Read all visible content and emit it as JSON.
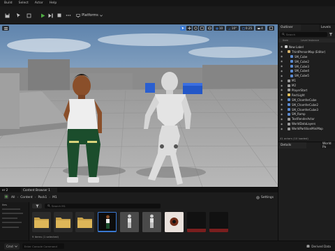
{
  "menu": [
    "Build",
    "Select",
    "Actor",
    "Help"
  ],
  "toolbar": {
    "platforms_label": "Platforms"
  },
  "viewport": {
    "grid_snap": "10",
    "rotation_snap": "10°",
    "scale_snap": "0.25",
    "camera_speed": "4"
  },
  "outliner": {
    "tab_outliner": "Outliner",
    "tab_levels": "Levels",
    "search_placeholder": "Search",
    "col_item": "Item",
    "col_level": "Level Instance",
    "items": [
      {
        "label": "New Label",
        "indent": 0,
        "color": "#cfcfcf"
      },
      {
        "label": "ThirdPersonMap (Editor)",
        "indent": 1,
        "color": "#d8b46a"
      },
      {
        "label": "SM_Cube",
        "indent": 2,
        "color": "#5b8ad0"
      },
      {
        "label": "SM_Cube2",
        "indent": 2,
        "color": "#5b8ad0"
      },
      {
        "label": "SM_Cube3",
        "indent": 2,
        "color": "#5b8ad0"
      },
      {
        "label": "SM_Cube4",
        "indent": 2,
        "color": "#5b8ad0"
      },
      {
        "label": "SM_Cube5",
        "indent": 2,
        "color": "#5b8ad0"
      },
      {
        "label": "M1",
        "indent": 1,
        "color": "#9b9b9b"
      },
      {
        "label": "M2",
        "indent": 1,
        "color": "#9b9b9b"
      },
      {
        "label": "PlayerStart",
        "indent": 1,
        "color": "#9b9b9b"
      },
      {
        "label": "RectLight",
        "indent": 1,
        "color": "#e2c05a"
      },
      {
        "label": "SM_ChamferCube",
        "indent": 1,
        "color": "#5b8ad0"
      },
      {
        "label": "SM_ChamferCube2",
        "indent": 1,
        "color": "#5b8ad0"
      },
      {
        "label": "SM_ChamferCube3",
        "indent": 1,
        "color": "#5b8ad0"
      },
      {
        "label": "SM_Ramp",
        "indent": 1,
        "color": "#5b8ad0"
      },
      {
        "label": "TextRenderActor",
        "indent": 1,
        "color": "#9b9b9b"
      },
      {
        "label": "WorldDataLayers",
        "indent": 1,
        "color": "#9b9b9b"
      },
      {
        "label": "WorldPartitionMiniMap",
        "indent": 1,
        "color": "#9b9b9b"
      }
    ],
    "footer": "41 actors (10 loaded)"
  },
  "details": {
    "tab_details": "Details",
    "tab_world": "World Pa"
  },
  "content_browser": {
    "tabs": [
      "er 2",
      "Content Browser 1"
    ],
    "path": [
      "All",
      "Content",
      "Pack1",
      "M1"
    ],
    "settings_label": "Settings",
    "search_placeholder": "Search M1",
    "sidebar": [
      "ites",
      "",
      "",
      "",
      "",
      ""
    ],
    "count": "9 items (1 selected)"
  },
  "statusbar": {
    "cmd_label": "Cmd",
    "console_placeholder": "Enter Console Command",
    "derived_label": "Derived Data"
  },
  "colors": {
    "accent": "#3a78d1",
    "play": "#4fae43"
  }
}
